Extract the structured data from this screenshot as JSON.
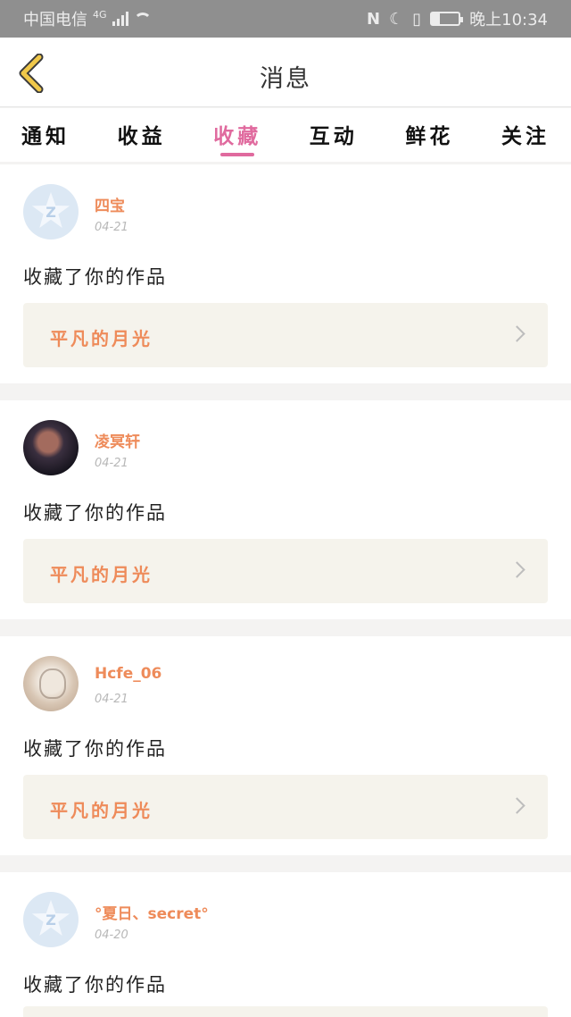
{
  "status_bar": {
    "carrier": "中国电信",
    "network": "4G",
    "time": "晚上10:34",
    "battery_level": 0.3,
    "icons": [
      "signal-icon",
      "wifi-icon",
      "nfc-icon",
      "moon-icon",
      "vibrate-icon",
      "battery-icon"
    ]
  },
  "header": {
    "title": "消息",
    "back_icon": "chevron-left-icon"
  },
  "tabs": [
    {
      "label": "通知"
    },
    {
      "label": "收益"
    },
    {
      "label": "收藏",
      "active": true
    },
    {
      "label": "互动"
    },
    {
      "label": "鲜花"
    },
    {
      "label": "关注"
    }
  ],
  "colors": {
    "accent": "#e06a9e",
    "name": "#ee8b5a",
    "back": "#f0c84a",
    "work_bg": "#f5f3ec"
  },
  "messages": [
    {
      "user": "四宝",
      "date": "04-21",
      "text": "收藏了你的作品",
      "work": "平凡的月光",
      "avatar": "default-avatar"
    },
    {
      "user": "凌冥轩",
      "date": "04-21",
      "text": "收藏了你的作品",
      "work": "平凡的月光",
      "avatar": "anime-avatar"
    },
    {
      "user": "Hcfe_06",
      "date": "04-21",
      "text": "收藏了你的作品",
      "work": "平凡的月光",
      "avatar": "sketch-avatar"
    },
    {
      "user": "°夏日、secret°",
      "date": "04-20",
      "text": "收藏了你的作品",
      "work": "",
      "avatar": "default-avatar"
    }
  ]
}
